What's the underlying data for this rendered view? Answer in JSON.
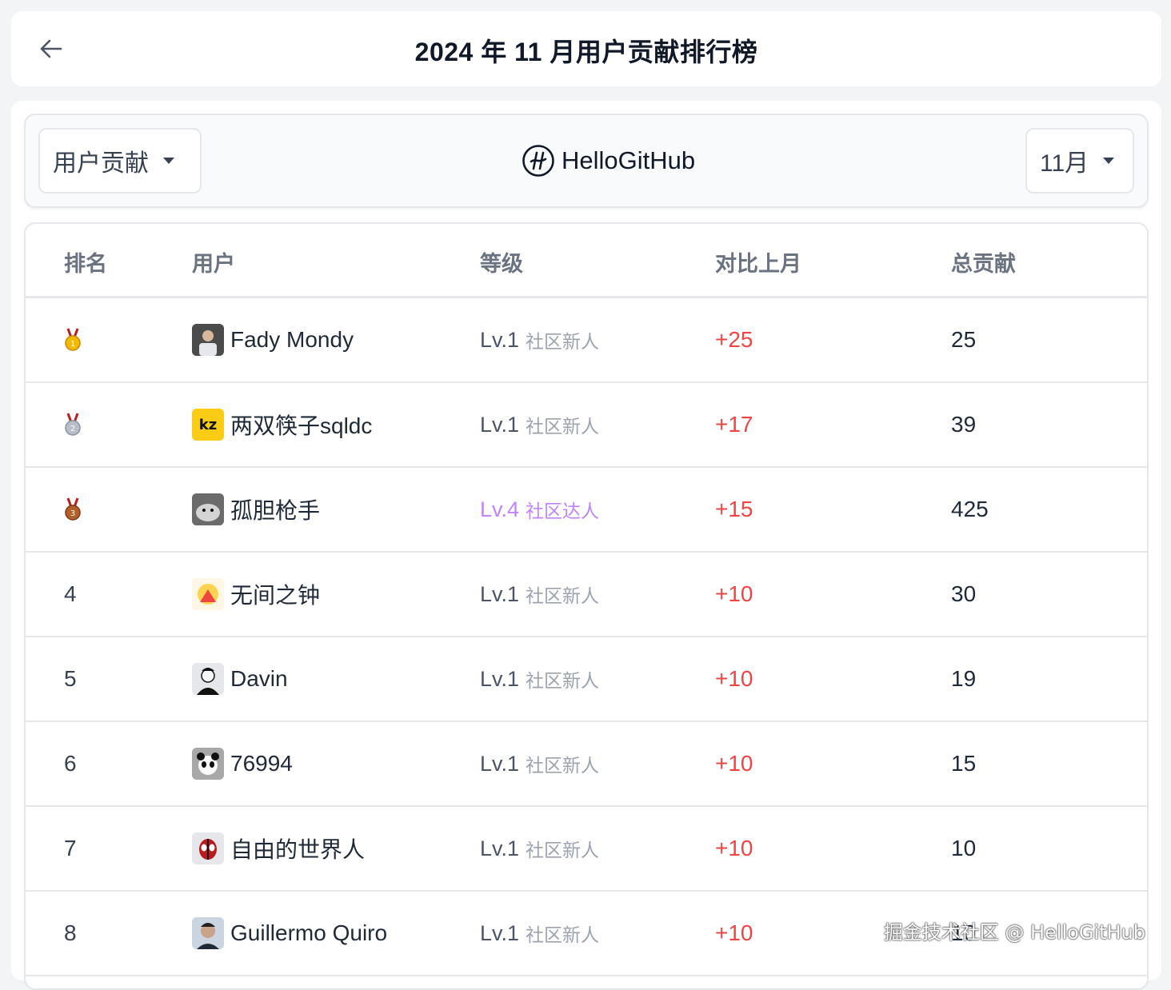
{
  "header": {
    "title": "2024 年 11 月用户贡献排行榜",
    "back_icon": "arrow-left-icon"
  },
  "toolbar": {
    "type_selector": "用户贡献",
    "brand": "HelloGitHub",
    "month_selector": "11月"
  },
  "table": {
    "columns": [
      "排名",
      "用户",
      "等级",
      "对比上月",
      "总贡献"
    ],
    "rows": [
      {
        "rank": "",
        "medal": "gold-medal-icon",
        "user": "Fady Mondy",
        "level": "Lv.1",
        "level_label": "社区新人",
        "diff": "+25",
        "total": "25"
      },
      {
        "rank": "",
        "medal": "silver-medal-icon",
        "user": "两双筷子sqldc",
        "level": "Lv.1",
        "level_label": "社区新人",
        "diff": "+17",
        "total": "39"
      },
      {
        "rank": "",
        "medal": "bronze-medal-icon",
        "user": "孤胆枪手",
        "level": "Lv.4",
        "level_label": "社区达人",
        "diff": "+15",
        "total": "425"
      },
      {
        "rank": "4",
        "user": "无间之钟",
        "level": "Lv.1",
        "level_label": "社区新人",
        "diff": "+10",
        "total": "30"
      },
      {
        "rank": "5",
        "user": "Davin",
        "level": "Lv.1",
        "level_label": "社区新人",
        "diff": "+10",
        "total": "19"
      },
      {
        "rank": "6",
        "user": "76994",
        "level": "Lv.1",
        "level_label": "社区新人",
        "diff": "+10",
        "total": "15"
      },
      {
        "rank": "7",
        "user": "自由的世界人",
        "level": "Lv.1",
        "level_label": "社区新人",
        "diff": "+10",
        "total": "10"
      },
      {
        "rank": "8",
        "user": "Guillermo Quiro",
        "level": "Lv.1",
        "level_label": "社区新人",
        "diff": "+10",
        "total": "10"
      }
    ]
  },
  "watermark": "掘金技术社区 @ HelloGitHub",
  "colors": {
    "diff_positive": "#ef4444",
    "level_4": "#c084fc",
    "gold": "#f5b800",
    "silver": "#9ca3af",
    "bronze": "#b45f2a"
  }
}
